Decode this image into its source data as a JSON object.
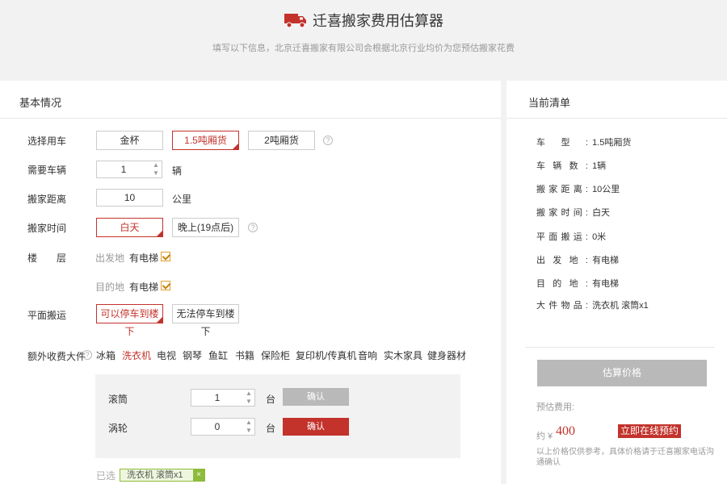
{
  "header": {
    "title": "迁喜搬家费用估算器",
    "subtitle": "填写以下信息，北京迁喜搬家有限公司会根据北京行业均价为您预估搬家花费"
  },
  "form": {
    "section_title": "基本情况",
    "vehicle": {
      "label": "选择用车",
      "options": [
        "金杯",
        "1.5吨厢货",
        "2吨厢货"
      ],
      "selected": "1.5吨厢货"
    },
    "count": {
      "label": "需要车辆",
      "value": "1",
      "unit": "辆"
    },
    "distance": {
      "label": "搬家距离",
      "value": "10",
      "unit": "公里"
    },
    "time": {
      "label": "搬家时间",
      "options": [
        "白天",
        "晚上(19点后)"
      ],
      "selected": "白天"
    },
    "floor": {
      "label": "楼　　层",
      "origin_label": "出发地",
      "origin_elevator": "有电梯",
      "dest_label": "目的地",
      "dest_elevator": "有电梯"
    },
    "flat": {
      "label": "平面搬运",
      "options": [
        "可以停车到楼下",
        "无法停车到楼下"
      ],
      "selected": "可以停车到楼下"
    },
    "extra": {
      "label": "额外收费大件",
      "categories": [
        "冰箱",
        "洗衣机",
        "电视",
        "钢琴",
        "鱼缸",
        "书籍",
        "保险柜",
        "复印机/传真机",
        "音响",
        "实木家具",
        "健身器材"
      ],
      "active": "洗衣机",
      "items": [
        {
          "name": "滚筒",
          "qty": "1",
          "unit": "台",
          "confirm": "确认"
        },
        {
          "name": "涡轮",
          "qty": "0",
          "unit": "台",
          "confirm": "确认"
        }
      ],
      "chosen_label": "已选",
      "chosen_tag": "洗衣机 滚筒x1",
      "remove_symbol": "×"
    }
  },
  "summary": {
    "title": "当前清单",
    "rows": [
      {
        "key": "车型:",
        "value": "1.5吨厢货"
      },
      {
        "key": "车辆数:",
        "value": "1辆"
      },
      {
        "key": "搬家距离:",
        "value": "10公里"
      },
      {
        "key": "搬家时间:",
        "value": "白天"
      },
      {
        "key": "平面搬运:",
        "value": "0米"
      },
      {
        "key": "出发地:",
        "value": "有电梯"
      },
      {
        "key": "目的地:",
        "value": "有电梯"
      },
      {
        "key": "大件物品:",
        "value": "洗衣机 滚筒x1"
      }
    ],
    "estimate_button": "估算价格",
    "estimate_label": "预估费用:",
    "price_prefix": "约 ¥",
    "price": "400",
    "book_button": "立即在线预约",
    "note": "以上价格仅供参考，具体价格请于迁喜搬家电话沟通确认"
  },
  "colors": {
    "accent": "#c3322b",
    "tag_green": "#8dbb3c",
    "check_orange": "#e0a030"
  },
  "icons": {
    "truck": "truck-icon",
    "help": "question-icon",
    "check": "checkbox-checked-icon"
  }
}
